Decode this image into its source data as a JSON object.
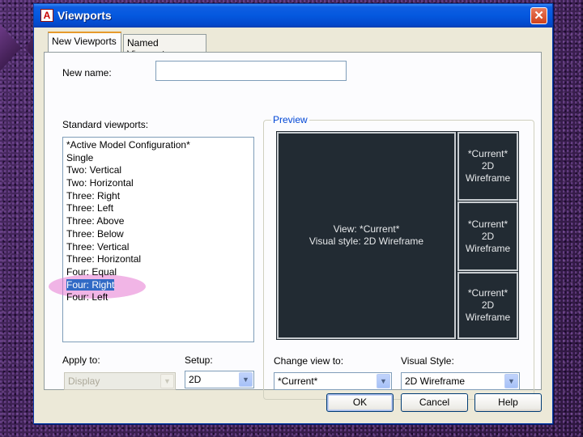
{
  "window": {
    "title": "Viewports",
    "app_icon": "A",
    "close_glyph": "✕"
  },
  "tabs": [
    {
      "label": "New Viewports",
      "active": true
    },
    {
      "label": "Named Viewports",
      "active": false
    }
  ],
  "new_name": {
    "label": "New name:",
    "value": ""
  },
  "standard_viewports": {
    "label": "Standard viewports:",
    "items": [
      "*Active Model Configuration*",
      "Single",
      "Two:  Vertical",
      "Two:  Horizontal",
      "Three: Right",
      "Three: Left",
      "Three: Above",
      "Three: Below",
      "Three: Vertical",
      "Three: Horizontal",
      "Four:  Equal",
      "Four:  Right",
      "Four:  Left"
    ],
    "selected_index": 11
  },
  "preview": {
    "label": "Preview",
    "main": {
      "line1": "View: *Current*",
      "line2": "Visual style: 2D Wireframe"
    },
    "side": [
      {
        "line1": "*Current*",
        "line2": "2D Wireframe"
      },
      {
        "line1": "*Current*",
        "line2": "2D Wireframe"
      },
      {
        "line1": "*Current*",
        "line2": "2D Wireframe"
      }
    ]
  },
  "apply_to": {
    "label": "Apply to:",
    "value": "Display",
    "disabled": true
  },
  "setup": {
    "label": "Setup:",
    "value": "2D"
  },
  "change_view": {
    "label": "Change view to:",
    "value": "*Current*"
  },
  "visual_style": {
    "label": "Visual Style:",
    "value": "2D Wireframe"
  },
  "buttons": {
    "ok": "OK",
    "cancel": "Cancel",
    "help": "Help"
  },
  "colors": {
    "titlebar": "#0458de",
    "dialog": "#ece9d8",
    "preview_bg": "#222b33",
    "selection": "#316ac5",
    "highlight_mark": "#e678d2",
    "desktop": "#3a1f4e"
  }
}
